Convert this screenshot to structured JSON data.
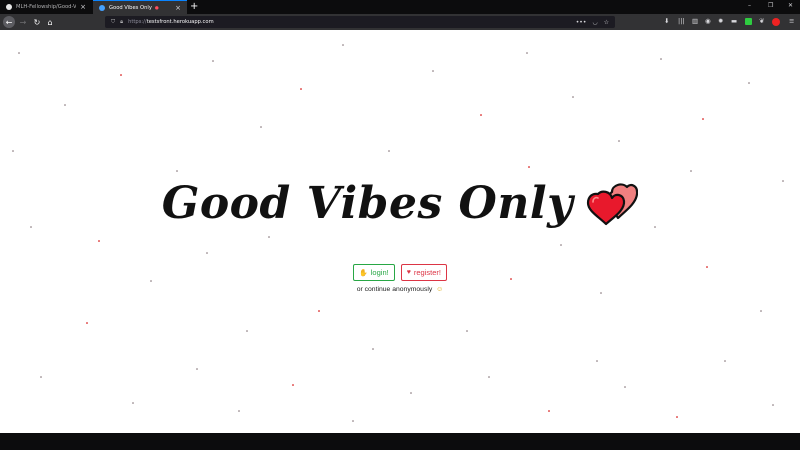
{
  "browser": {
    "tabs": [
      {
        "title": "MLH-Fellowship/Good-Vibes…",
        "active": false
      },
      {
        "title": "Good Vibes Only",
        "active": true
      }
    ],
    "url_proto": "https://",
    "url_host": "testsfront.herokuapp.com",
    "icons": {
      "close": "close-icon",
      "new_tab": "plus-icon",
      "back": "arrow-left-icon",
      "forward": "arrow-right-icon",
      "reload": "reload-icon",
      "home": "home-icon",
      "lock": "lock-icon",
      "page_actions": "more-icon",
      "pocket": "pocket-icon",
      "bookmark": "star-icon"
    },
    "accent_color": "#0a84ff"
  },
  "page": {
    "title": "Good Vibes Only",
    "login_label": "login!",
    "register_label": "register!",
    "anonymous_text": "or continue anonymously",
    "colors": {
      "login": "#28a745",
      "register": "#dc3545",
      "heart_front": "#e8192c",
      "heart_back": "#f08080"
    }
  }
}
